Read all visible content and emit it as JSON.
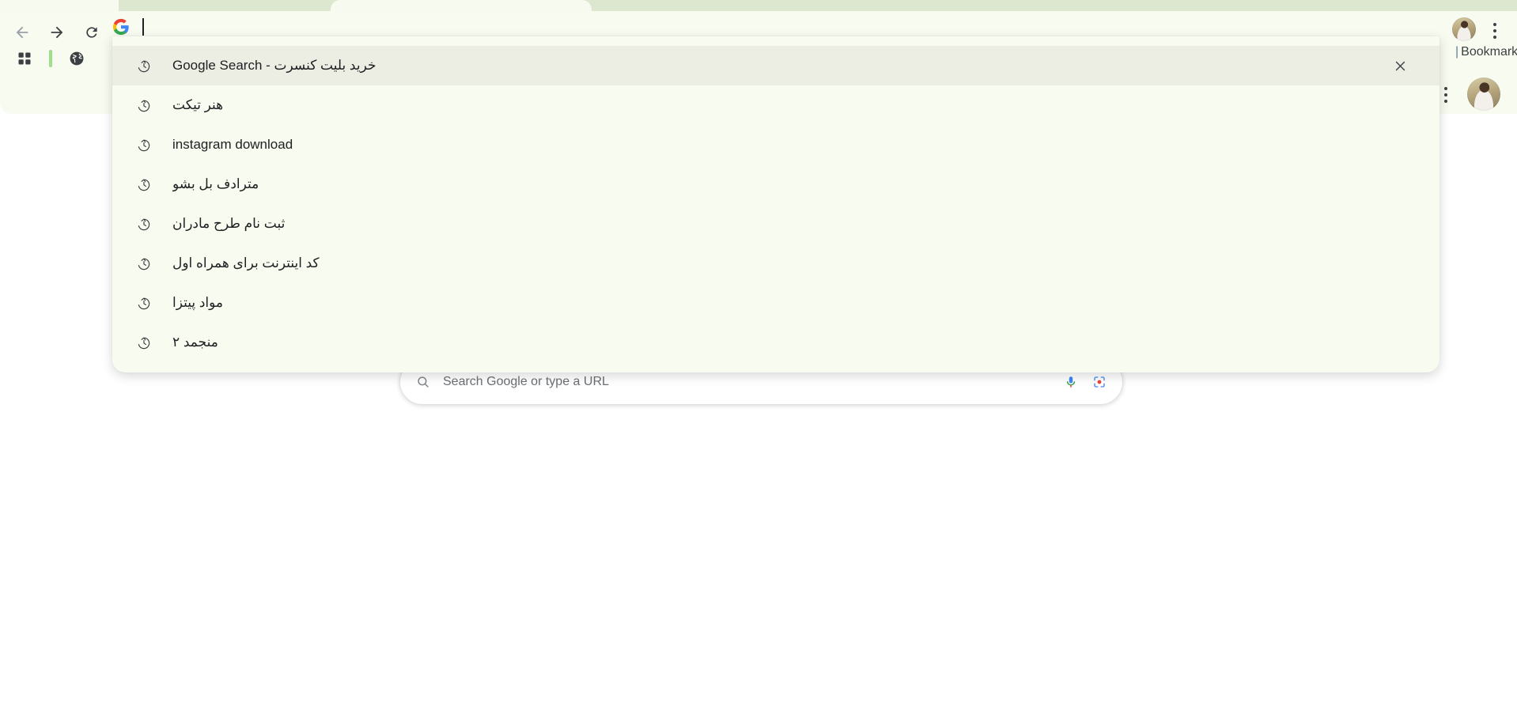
{
  "window": {
    "chrome_bg": "#f8fbf0",
    "tabstrip_bg": "#dde6cf",
    "dropdown_bg": "#f8fbef",
    "selected_row_bg": "#eceee4",
    "accent_green": "#9ede8c"
  },
  "toolbar": {
    "back_label": "Back",
    "forward_label": "Forward",
    "reload_label": "Reload",
    "back_icon": "arrow-left-icon",
    "forward_icon": "arrow-right-icon",
    "reload_icon": "reload-icon"
  },
  "bookmarks_bar": {
    "apps_icon": "apps-grid-icon",
    "apps_label": "All Bookmarks",
    "globe_icon": "globe-icon",
    "globe_label": "Web"
  },
  "omnibox": {
    "favicon": "google-g-icon",
    "value": "",
    "placeholder": "Search Google or type a URL",
    "caret_visible": true
  },
  "profile": {
    "avatar_icon": "avatar",
    "menu_icon": "kebab-menu-icon",
    "side_menu_icon": "kebab-menu-icon",
    "side_avatar_icon": "avatar"
  },
  "bookmarks_label": {
    "separator": "|",
    "text": "Bookmarks"
  },
  "page": {
    "search_placeholder": "Search Google or type a URL",
    "search_icon": "search-icon",
    "mic_icon": "microphone-icon",
    "lens_icon": "google-lens-icon"
  },
  "dropdown": {
    "remove_icon": "close-icon",
    "history_icon": "history-clock-icon",
    "suggestions": [
      {
        "text": "خرید بلیت کنسرت - Google Search",
        "type": "history",
        "selected": true,
        "removable": true,
        "rtl": true
      },
      {
        "text": "هنر تیکت",
        "type": "history",
        "selected": false,
        "removable": false,
        "rtl": true
      },
      {
        "text": "instagram download",
        "type": "history",
        "selected": false,
        "removable": false,
        "rtl": false
      },
      {
        "text": "مترادف بل بشو",
        "type": "history",
        "selected": false,
        "removable": false,
        "rtl": true
      },
      {
        "text": "ثبت نام طرح مادران",
        "type": "history",
        "selected": false,
        "removable": false,
        "rtl": true
      },
      {
        "text": "کد اینترنت برای همراه اول",
        "type": "history",
        "selected": false,
        "removable": false,
        "rtl": true
      },
      {
        "text": "مواد پیتزا",
        "type": "history",
        "selected": false,
        "removable": false,
        "rtl": true
      },
      {
        "text": "منجمد ۲",
        "type": "history",
        "selected": false,
        "removable": false,
        "rtl": true
      }
    ]
  }
}
